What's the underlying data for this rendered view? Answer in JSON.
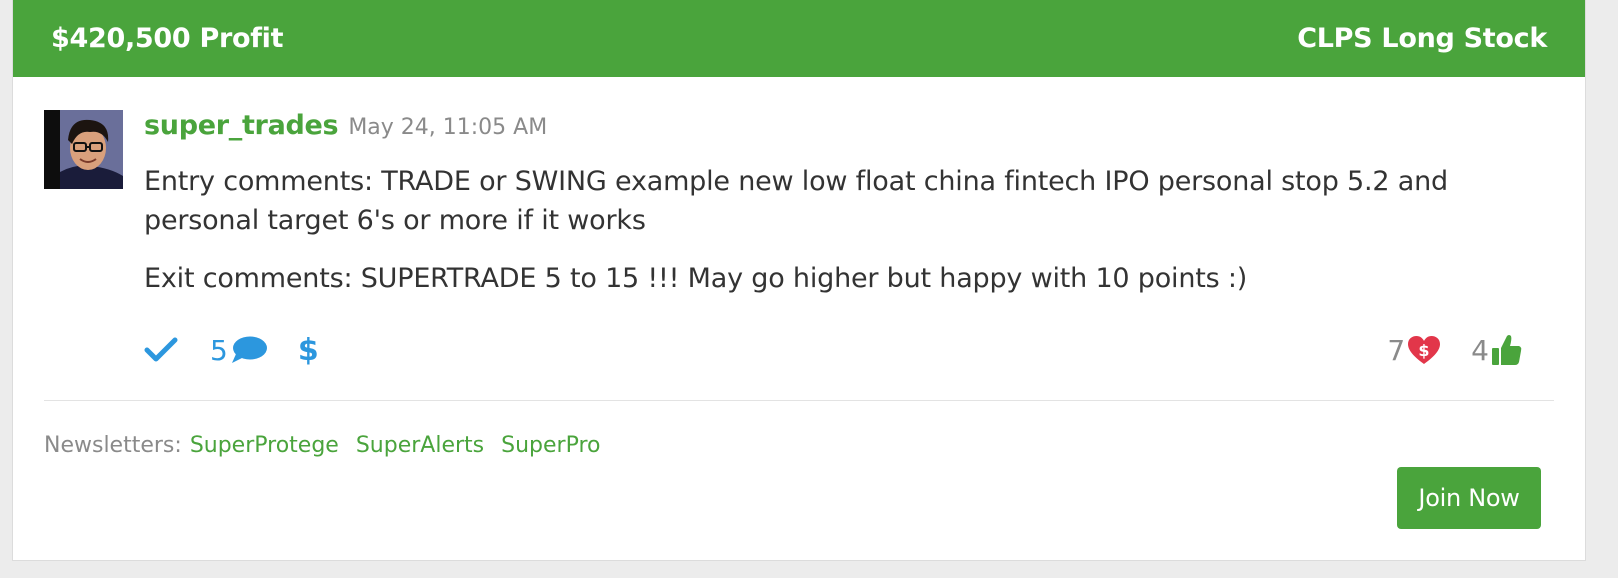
{
  "header": {
    "profit": "$420,500 Profit",
    "trade": "CLPS Long Stock"
  },
  "post": {
    "username": "super_trades",
    "timestamp": "May 24, 11:05 AM",
    "entry_comment": "Entry comments: TRADE or SWING example new low float china fintech IPO personal stop 5.2 and personal target 6's or more if it works",
    "exit_comment": "Exit comments: SUPERTRADE 5 to 15 !!! May go higher but happy with 10 points :)"
  },
  "actions": {
    "icons": [
      "check-icon",
      "comment-bubble-icon",
      "dollar-icon"
    ],
    "comment_count": "5"
  },
  "reactions": {
    "tips_count": "7",
    "likes_count": "4",
    "icons": [
      "heart-dollar-icon",
      "thumbs-up-icon"
    ]
  },
  "newsletters": {
    "label": "Newsletters:",
    "items": [
      "SuperProtege",
      "SuperAlerts",
      "SuperPro"
    ]
  },
  "cta": {
    "join_label": "Join Now"
  },
  "colors": {
    "brand_green": "#4aa43c",
    "action_blue": "#2c97de",
    "heart_red": "#e2364a",
    "muted_gray": "#8a8a8a"
  }
}
